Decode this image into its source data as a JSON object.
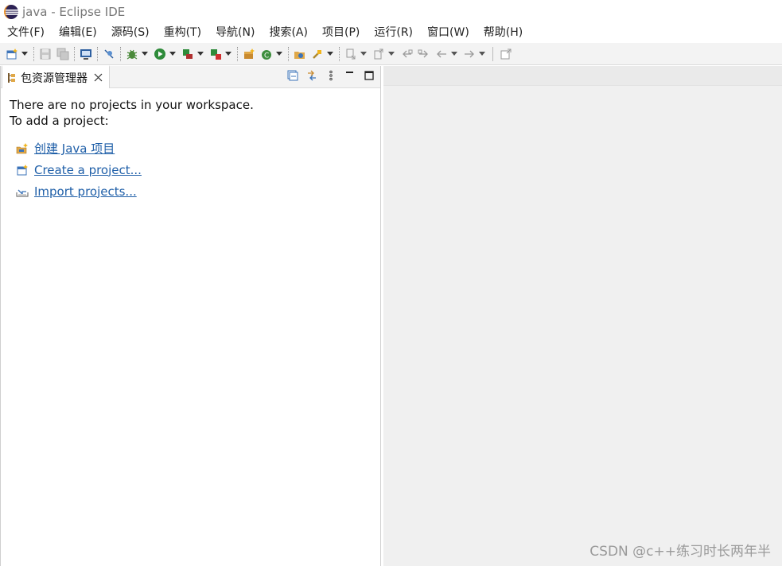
{
  "window": {
    "title": "java - Eclipse IDE"
  },
  "menubar": {
    "items": [
      "文件(F)",
      "编辑(E)",
      "源码(S)",
      "重构(T)",
      "导航(N)",
      "搜索(A)",
      "项目(P)",
      "运行(R)",
      "窗口(W)",
      "帮助(H)"
    ]
  },
  "panel": {
    "tab_label": "包资源管理器",
    "message_line1": "There are no projects in your workspace.",
    "message_line2": "To add a project:",
    "links": [
      {
        "label": "创建 Java 项目",
        "icon": "new-java-project-icon"
      },
      {
        "label": "Create a project...",
        "icon": "new-project-icon"
      },
      {
        "label": "Import projects...",
        "icon": "import-icon"
      }
    ]
  },
  "watermark": "CSDN @c++练习时长两年半",
  "colors": {
    "link": "#1f5fa8",
    "toolbar_bg": "#f3f3f3",
    "editor_bg": "#f0f0f0"
  }
}
